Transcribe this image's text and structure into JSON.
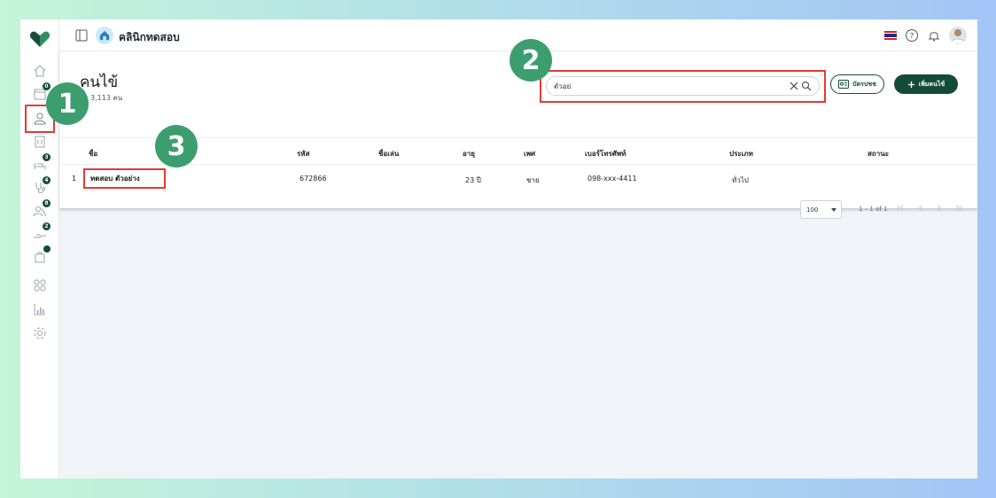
{
  "app": {
    "clinic_name": "คลินิกทดสอบ"
  },
  "sidebar": {
    "badges": [
      "0",
      "3",
      "4",
      "8",
      "2",
      ""
    ]
  },
  "page": {
    "title": "คนไข้",
    "count": "3,113 คน"
  },
  "search": {
    "value": "ตัวอย่",
    "placeholder": ""
  },
  "buttons": {
    "id_card": "บัตรปชช",
    "add_patient": "เพิ่มคนไข้"
  },
  "table": {
    "headers": {
      "name": "ชื่อ",
      "code": "รหัส",
      "nickname": "ชื่อเล่น",
      "age": "อายุ",
      "gender": "เพศ",
      "phone": "เบอร์โทรศัพท์",
      "type": "ประเภท",
      "status": "สถานะ"
    },
    "rows": [
      {
        "index": "1",
        "name": "ทดสอบ ตัวอย่าง",
        "code": "672866",
        "nickname": "",
        "age": "23 ปี",
        "gender": "ชาย",
        "phone": "098-xxx-4411",
        "type": "ทั่วไป",
        "status": ""
      }
    ]
  },
  "pagination": {
    "page_size": "100",
    "range": "1 – 1 of 1"
  },
  "steps": [
    "1",
    "2",
    "3"
  ],
  "colors": {
    "primary": "#134b39",
    "step": "#3c9e6e",
    "highlight": "#e53935"
  }
}
